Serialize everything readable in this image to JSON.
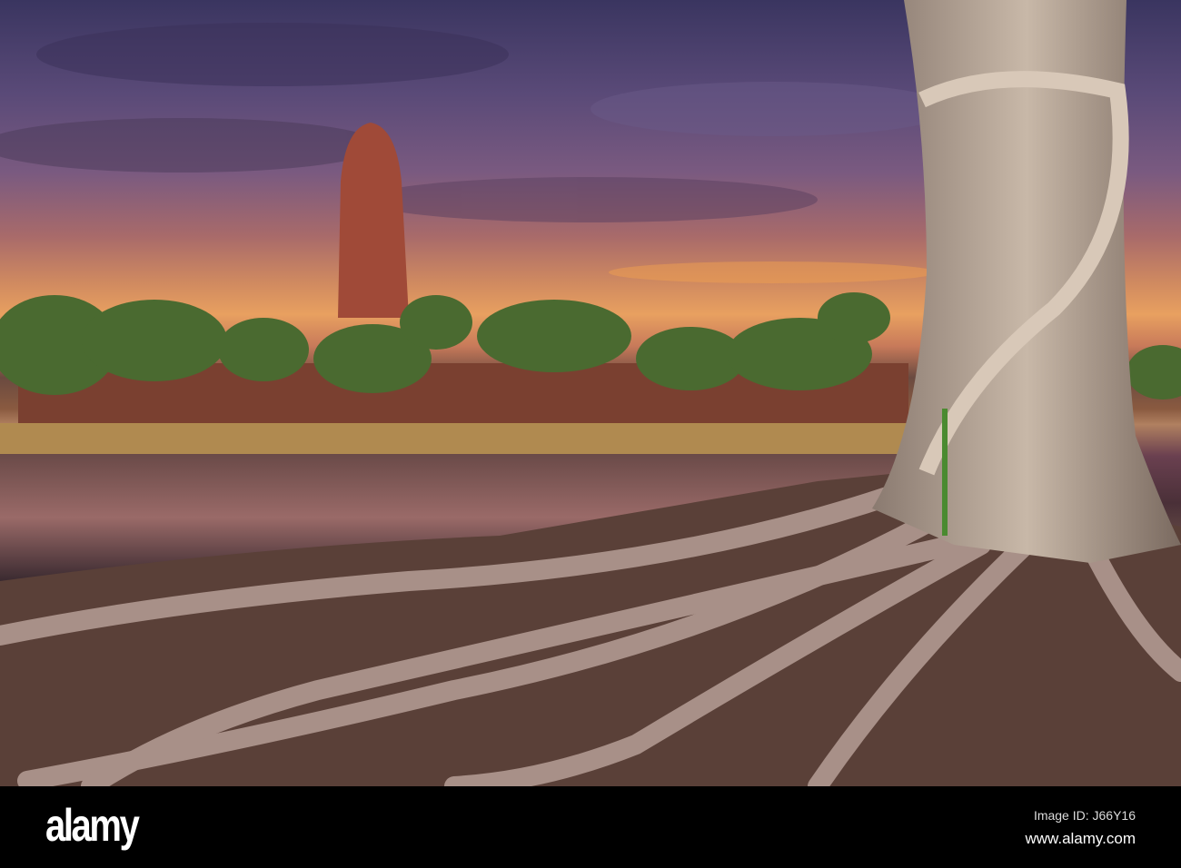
{
  "image": {
    "subject": "Ancient temple ruin with banyan tree roots by a pond at sunset"
  },
  "footer": {
    "logo": "alamy",
    "image_id": "Image ID: J66Y16",
    "website": "www.alamy.com"
  }
}
